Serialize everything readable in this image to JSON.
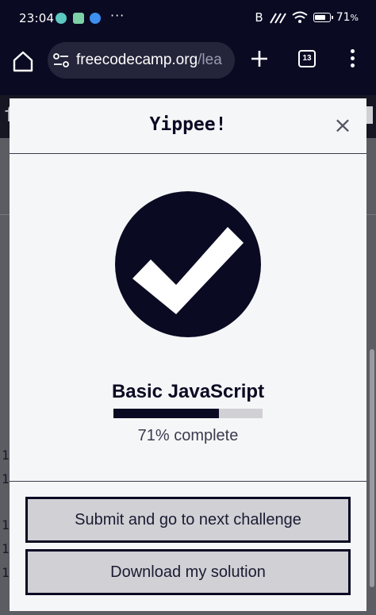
{
  "status_bar": {
    "time": "23:04",
    "more": "···",
    "bluetooth": "B",
    "battery": "71",
    "percent_sign": "%"
  },
  "browser": {
    "url_main": "freecodecamp.org",
    "url_rest": "/lea",
    "tab_count": "13"
  },
  "backdrop": {
    "letter": "f",
    "line_numbers": [
      "1",
      "1",
      "1",
      "1",
      "1"
    ]
  },
  "modal": {
    "title": "Yippee!",
    "close": "×",
    "certification": "Basic JavaScript",
    "progress_percent": 71,
    "progress_label": "71% complete",
    "submit_button": "Submit and go to next challenge",
    "download_button": "Download my solution"
  },
  "colors": {
    "accent_dark": "#0a0a23",
    "modal_bg": "#f5f6f7",
    "button_bg": "#d0d0d5",
    "status_teal": "#5cc8c0",
    "status_green": "#7cd1a6",
    "status_blue": "#3d8ff0"
  },
  "icons": [
    "home-icon",
    "tune-icon",
    "plus-icon",
    "tabs-icon",
    "more-vert-icon",
    "checkmark-icon",
    "close-icon",
    "wifi-icon",
    "signal-icon",
    "battery-icon",
    "bluetooth-icon"
  ]
}
